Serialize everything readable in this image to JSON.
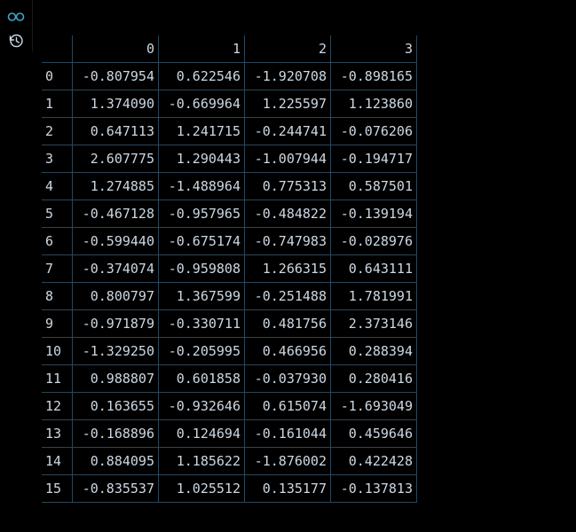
{
  "icons": {
    "view": "glasses-icon",
    "history": "history-icon"
  },
  "chart_data": {
    "type": "table",
    "columns": [
      "0",
      "1",
      "2",
      "3"
    ],
    "index": [
      "0",
      "1",
      "2",
      "3",
      "4",
      "5",
      "6",
      "7",
      "8",
      "9",
      "10",
      "11",
      "12",
      "13",
      "14",
      "15"
    ],
    "rows": [
      [
        "-0.807954",
        " 0.622546",
        "-1.920708",
        "-0.898165"
      ],
      [
        " 1.374090",
        "-0.669964",
        " 1.225597",
        " 1.123860"
      ],
      [
        " 0.647113",
        " 1.241715",
        "-0.244741",
        "-0.076206"
      ],
      [
        " 2.607775",
        " 1.290443",
        "-1.007944",
        "-0.194717"
      ],
      [
        " 1.274885",
        "-1.488964",
        " 0.775313",
        " 0.587501"
      ],
      [
        "-0.467128",
        "-0.957965",
        "-0.484822",
        "-0.139194"
      ],
      [
        "-0.599440",
        "-0.675174",
        "-0.747983",
        "-0.028976"
      ],
      [
        "-0.374074",
        "-0.959808",
        " 1.266315",
        " 0.643111"
      ],
      [
        " 0.800797",
        " 1.367599",
        "-0.251488",
        " 1.781991"
      ],
      [
        "-0.971879",
        "-0.330711",
        " 0.481756",
        " 2.373146"
      ],
      [
        "-1.329250",
        "-0.205995",
        " 0.466956",
        " 0.288394"
      ],
      [
        " 0.988807",
        " 0.601858",
        "-0.037930",
        " 0.280416"
      ],
      [
        " 0.163655",
        "-0.932646",
        " 0.615074",
        "-1.693049"
      ],
      [
        "-0.168896",
        " 0.124694",
        "-0.161044",
        " 0.459646"
      ],
      [
        " 0.884095",
        " 1.185622",
        "-1.876002",
        " 0.422428"
      ],
      [
        "-0.835537",
        " 1.025512",
        " 0.135177",
        "-0.137813"
      ]
    ]
  }
}
